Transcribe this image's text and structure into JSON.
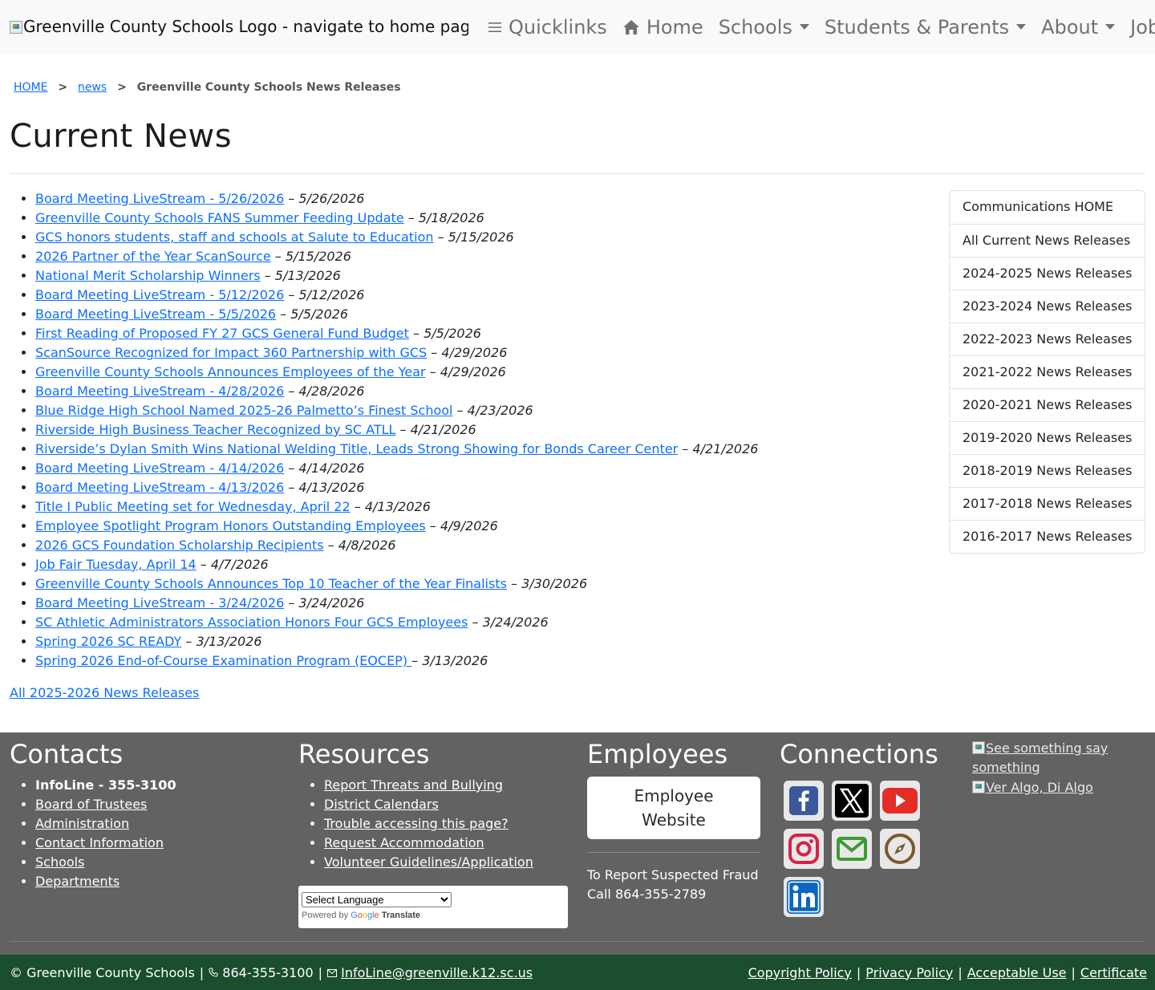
{
  "nav": {
    "logo_alt": "Greenville County Schools Logo - navigate to home page",
    "quicklinks": "Quicklinks",
    "home": "Home",
    "schools": "Schools",
    "students_parents": "Students & Parents",
    "about": "About",
    "jobs": "Jobs"
  },
  "breadcrumb": {
    "home": "HOME",
    "sep1": ">",
    "news": "news",
    "sep2": ">",
    "current": "Greenville County Schools News Releases"
  },
  "page_title": "Current News",
  "news": [
    {
      "title": "Board Meeting LiveStream - 5/26/2026",
      "date": "5/26/2026"
    },
    {
      "title": "Greenville County Schools FANS Summer Feeding Update",
      "date": "5/18/2026"
    },
    {
      "title": "GCS honors students, staff and schools at Salute to Education",
      "date": "5/15/2026"
    },
    {
      "title": "2026 Partner of the Year ScanSource",
      "date": "5/15/2026"
    },
    {
      "title": "National Merit Scholarship Winners",
      "date": "5/13/2026"
    },
    {
      "title": "Board Meeting LiveStream - 5/12/2026",
      "date": "5/12/2026"
    },
    {
      "title": "Board Meeting LiveStream - 5/5/2026",
      "date": "5/5/2026"
    },
    {
      "title": "First Reading of Proposed FY 27 GCS General Fund Budget",
      "date": "5/5/2026"
    },
    {
      "title": "ScanSource Recognized for Impact 360 Partnership with GCS",
      "date": "4/29/2026"
    },
    {
      "title": "Greenville County Schools Announces Employees of the Year",
      "date": "4/29/2026"
    },
    {
      "title": "Board Meeting LiveStream - 4/28/2026",
      "date": "4/28/2026"
    },
    {
      "title": "Blue Ridge High School Named 2025-26 Palmetto’s Finest School",
      "date": "4/23/2026"
    },
    {
      "title": "Riverside High Business Teacher Recognized by SC ATLL",
      "date": "4/21/2026"
    },
    {
      "title": "Riverside’s Dylan Smith Wins National Welding Title, Leads Strong Showing for Bonds Career Center",
      "date": "4/21/2026"
    },
    {
      "title": "Board Meeting LiveStream - 4/14/2026",
      "date": "4/14/2026"
    },
    {
      "title": "Board Meeting LiveStream - 4/13/2026",
      "date": "4/13/2026"
    },
    {
      "title": "Title I Public Meeting set for Wednesday, April 22",
      "date": "4/13/2026"
    },
    {
      "title": "Employee Spotlight Program Honors Outstanding Employees",
      "date": "4/9/2026"
    },
    {
      "title": "2026 GCS Foundation Scholarship Recipients",
      "date": "4/8/2026"
    },
    {
      "title": "Job Fair Tuesday, April 14",
      "date": "4/7/2026"
    },
    {
      "title": "Greenville County Schools Announces Top 10 Teacher of the Year Finalists",
      "date": "3/30/2026"
    },
    {
      "title": "Board Meeting LiveStream - 3/24/2026",
      "date": "3/24/2026"
    },
    {
      "title": "SC Athletic Administrators Association Honors Four GCS Employees",
      "date": "3/24/2026"
    },
    {
      "title": "Spring 2026 SC READY",
      "date": "3/13/2026"
    },
    {
      "title": "Spring 2026 End-of-Course Examination Program (EOCEP) ",
      "date": "3/13/2026"
    }
  ],
  "date_separator": " – ",
  "all_releases_link": "All 2025-2026 News Releases",
  "sidebar": [
    "Communications HOME",
    "All Current News Releases",
    "2024-2025 News Releases",
    "2023-2024 News Releases",
    "2022-2023 News Releases",
    "2021-2022 News Releases",
    "2020-2021 News Releases",
    "2019-2020 News Releases",
    "2018-2019 News Releases",
    "2017-2018 News Releases",
    "2016-2017 News Releases"
  ],
  "footer": {
    "contacts": {
      "heading": "Contacts",
      "infoline": "InfoLine - 355-3100",
      "links": [
        "Board of Trustees",
        "Administration",
        "Contact Information",
        "Schools",
        "Departments"
      ]
    },
    "resources": {
      "heading": "Resources",
      "links": [
        "Report Threats and Bullying",
        "District Calendars",
        "Trouble accessing this page?",
        "Request Accommodation",
        "Volunteer Guidelines/Application"
      ],
      "translate_select": "Select Language",
      "powered_by": "Powered by",
      "google": [
        "G",
        "o",
        "o",
        "g",
        "l",
        "e"
      ],
      "translate": "Translate"
    },
    "employees": {
      "heading": "Employees",
      "button": "Employee Website",
      "fraud_line1": "To Report Suspected Fraud",
      "fraud_line2": "Call 864-355-2789"
    },
    "connections": {
      "heading": "Connections",
      "icons": [
        "facebook-icon",
        "x-twitter-icon",
        "youtube-icon",
        "instagram-icon",
        "email-icon",
        "compass-icon",
        "linkedin-icon"
      ]
    },
    "see_something": "See something say something",
    "ver_algo": "Ver Algo, Di Algo"
  },
  "bottom_bar": {
    "copyright": "© Greenville County Schools",
    "phone": "864-355-3100",
    "email": "InfoLine@greenville.k12.sc.us",
    "pipe": "|",
    "copyright_policy": "Copyright Policy",
    "privacy_policy": "Privacy Policy",
    "acceptable_use": "Acceptable Use",
    "certificate": "Certificate"
  },
  "colors": {
    "link": "#0d6efd",
    "footer_bg": "#626262",
    "bottom_bar_bg": "#1b4d2f",
    "facebook": "#3b5998",
    "youtube": "#e52d27",
    "instagram": "#d62246",
    "email_green": "#3c9b35",
    "compass_brown": "#7a5a2f",
    "linkedin": "#0a66c2"
  }
}
